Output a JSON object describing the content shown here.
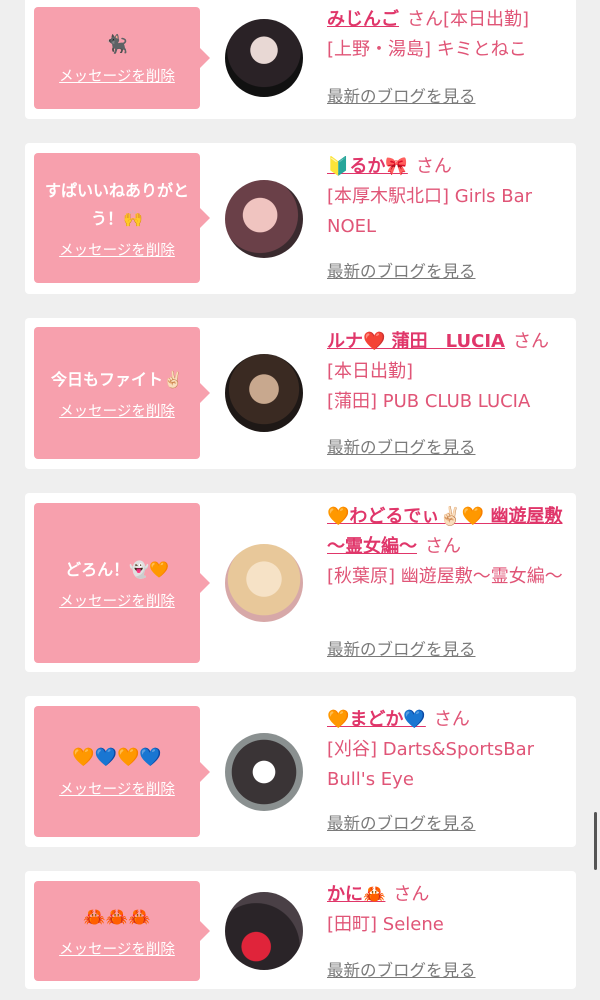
{
  "cards": [
    {
      "message": "🐈‍⬛",
      "delete_label": "メッセージを削除",
      "name": "みじんご",
      "san": "さん",
      "shop_line1": "[本日出勤]",
      "shop_line2": "[上野・湯島] キミとねこ",
      "blog_label": "最新のブログを見る"
    },
    {
      "message": "すぱいいねありがとう！🙌",
      "delete_label": "メッセージを削除",
      "name": "🔰るか🎀",
      "san": "さん",
      "shop_line1": "[本厚木駅北口] Girls Bar NOEL",
      "blog_label": "最新のブログを見る"
    },
    {
      "message": "今日もファイト✌🏻",
      "delete_label": "メッセージを削除",
      "name": "ルナ❤️ 蒲田　LUCIA",
      "san": "さん",
      "shop_line1": "[本日出勤]",
      "shop_line2": "[蒲田] PUB CLUB LUCIA",
      "blog_label": "最新のブログを見る"
    },
    {
      "message": "どろん！👻🧡",
      "delete_label": "メッセージを削除",
      "name": "🧡わどるでぃ✌🏻🧡 幽遊屋敷 〜霊女編〜",
      "san": "さん",
      "shop_line1": "[秋葉原] 幽遊屋敷〜霊女編〜",
      "blog_label": "最新のブログを見る"
    },
    {
      "message": "🧡💙🧡💙",
      "delete_label": "メッセージを削除",
      "name": "🧡まどか💙",
      "san": "さん",
      "shop_line1": "[刈谷] Darts&SportsBar Bull's Eye",
      "blog_label": "最新のブログを見る"
    },
    {
      "message": "🦀🦀🦀",
      "delete_label": "メッセージを削除",
      "name": "かに🦀",
      "san": "さん",
      "shop_line1": "[田町] Selene",
      "blog_label": "最新のブログを見る"
    }
  ],
  "colors": {
    "bubble": "#f7a0ad",
    "accent": "#e0366a",
    "background": "#efefef"
  }
}
